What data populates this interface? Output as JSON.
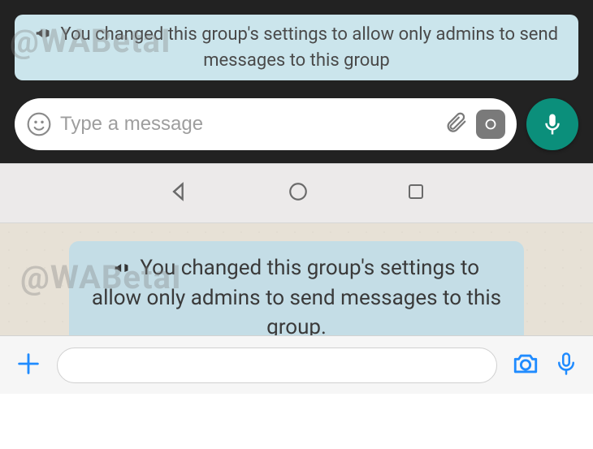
{
  "watermark_text": "@WABetaI",
  "android": {
    "system_message": "You changed this group's settings to allow only admins to send messages to this group",
    "input_placeholder": "Type a message"
  },
  "ios": {
    "system_message": "You changed this group's settings to allow only admins to send messages to this group."
  }
}
